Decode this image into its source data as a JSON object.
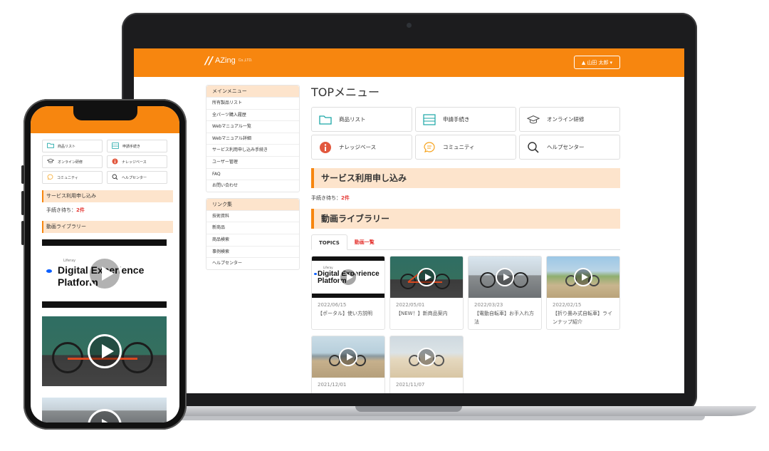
{
  "app": {
    "logo_text": "AZing",
    "logo_sub": "Co.,LTD.",
    "user_label": "山田 太郎",
    "user_caret": "▾"
  },
  "sidebar": {
    "main_title": "メインメニュー",
    "main_items": [
      "所有製品リスト",
      "全パーツ購入履歴",
      "Webマニュアル一覧",
      "Webマニュアル詳細",
      "サービス利用申し込み手続き",
      "ユーザー管理",
      "FAQ",
      "お問い合わせ"
    ],
    "links_title": "リンク集",
    "links_items": [
      "技術資料",
      "新商品",
      "商品検索",
      "事例検索",
      "ヘルプセンター"
    ]
  },
  "main": {
    "title": "TOPメニュー",
    "menu": [
      {
        "label": "商品リスト",
        "icon": "folder-icon",
        "color": "#1aa6a6"
      },
      {
        "label": "申請手続き",
        "icon": "form-icon",
        "color": "#1aa6a6"
      },
      {
        "label": "オンライン研修",
        "icon": "graduation-cap-icon",
        "color": "#555555"
      },
      {
        "label": "ナレッジベース",
        "icon": "info-icon",
        "color": "#e2583e"
      },
      {
        "label": "コミュニティ",
        "icon": "chat-icon",
        "color": "#f7a31c"
      },
      {
        "label": "ヘルプセンター",
        "icon": "magnifier-icon",
        "color": "#333333"
      }
    ],
    "service_title": "サービス利用申し込み",
    "pending_label": "手続き待ち：",
    "pending_count": "2件",
    "video_title": "動画ライブラリー",
    "tabs": [
      "TOPICS",
      "動画一覧"
    ],
    "videos": [
      {
        "date": "2022/06/15",
        "title": "【ポータル】使い方説明"
      },
      {
        "date": "2022/05/01",
        "title": "【NEW！】新商品案内"
      },
      {
        "date": "2022/03/23",
        "title": "【電動自転車】お手入れ方法"
      },
      {
        "date": "2022/02/15",
        "title": "【折り畳み式自転車】ラインナップ紹介"
      },
      {
        "date": "2021/12/01",
        "title": ""
      },
      {
        "date": "2021/11/07",
        "title": ""
      }
    ],
    "thumb_liferay_small": "Liferay",
    "thumb_liferay_big_1": "Digital Experience",
    "thumb_liferay_big_2": "Platform"
  },
  "phone": {
    "menu": [
      {
        "label": "商品リスト",
        "icon": "folder-icon"
      },
      {
        "label": "申請手続き",
        "icon": "form-icon"
      },
      {
        "label": "オンライン研修",
        "icon": "graduation-cap-icon"
      },
      {
        "label": "ナレッジベース",
        "icon": "info-icon"
      },
      {
        "label": "コミュニティ",
        "icon": "chat-icon"
      },
      {
        "label": "ヘルプセンター",
        "icon": "magnifier-icon"
      }
    ],
    "service_title": "サービス利用申し込み",
    "pending_label": "手続き待ち：",
    "pending_count": "2件",
    "video_title": "動画ライブラリー",
    "thumb_small": "Liferay",
    "thumb_big_1": "Digital Experience",
    "thumb_big_2": "Platform"
  },
  "colors": {
    "accent": "#f7860f",
    "accent_light": "#fde4cc",
    "alert": "#e53935"
  }
}
